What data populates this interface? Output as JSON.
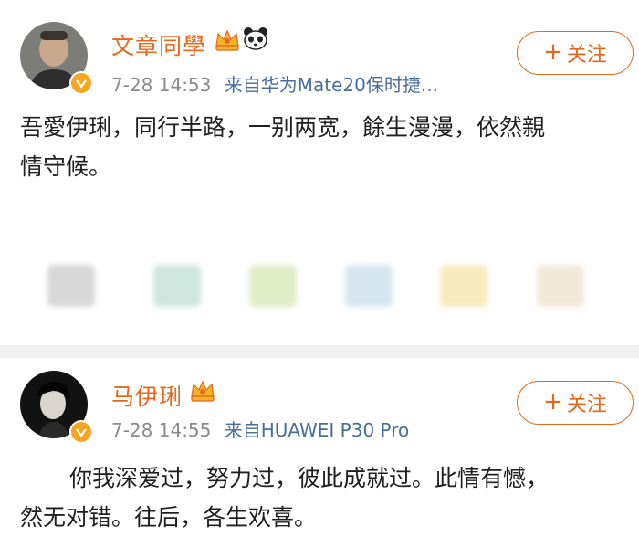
{
  "post1": {
    "username": "文章同學",
    "time": "7-28 14:53",
    "source": "来自华为Mate20保时捷...",
    "follow_label": "关注",
    "text_line1": "吾愛伊琍，同行半路，一别两宽，餘生漫漫，依然親",
    "text_line2": "情守候。",
    "avatar_icon": "avatar-photo",
    "crown_icon": "crown-icon",
    "panda_icon": "panda-icon"
  },
  "post2": {
    "username": "马伊琍",
    "time": "7-28 14:55",
    "source": "来自HUAWEI P30 Pro",
    "follow_label": "关注",
    "text_line1": "你我深爱过，努力过，彼此成就过。此情有憾，",
    "text_line2": "然无对错。往后，各生欢喜。",
    "crown_icon": "crown-icon"
  },
  "colors": {
    "accent": "#e8671b",
    "meta": "#8a8a8a",
    "source_link": "#4a6e9c",
    "badge": "#f6a623"
  }
}
